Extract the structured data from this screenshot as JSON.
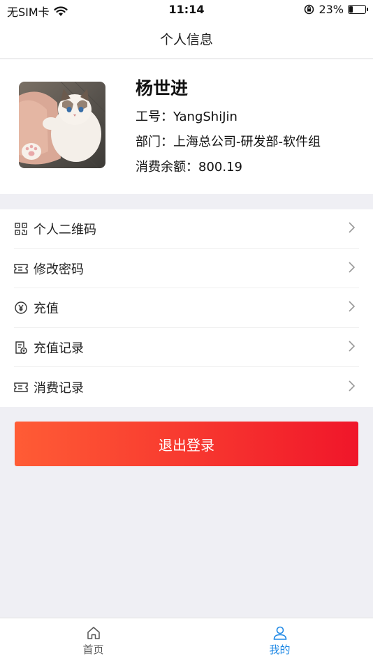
{
  "status_bar": {
    "carrier": "无SIM卡",
    "time": "11:14",
    "battery_percent": "23%",
    "battery_level": 0.23
  },
  "nav": {
    "title": "个人信息"
  },
  "profile": {
    "name": "杨世进",
    "employee_id_line": "工号：YangShiJin",
    "department_line": "部门：上海总公司-研发部-软件组",
    "balance_line": "消费余额：800.19"
  },
  "menu": {
    "items": [
      {
        "label": "个人二维码",
        "icon": "qr-code-icon"
      },
      {
        "label": "修改密码",
        "icon": "ticket-icon"
      },
      {
        "label": "充值",
        "icon": "yen-icon"
      },
      {
        "label": "充值记录",
        "icon": "record-icon"
      },
      {
        "label": "消费记录",
        "icon": "ticket-icon"
      }
    ]
  },
  "logout": {
    "label": "退出登录"
  },
  "tab_bar": {
    "tabs": [
      {
        "label": "首页",
        "icon": "home-icon",
        "active": false
      },
      {
        "label": "我的",
        "icon": "user-icon",
        "active": true
      }
    ]
  },
  "colors": {
    "accent_blue": "#1e88e5",
    "logout_gradient_start": "#ff5c35",
    "logout_gradient_end": "#f0162a",
    "background": "#efeff4"
  }
}
